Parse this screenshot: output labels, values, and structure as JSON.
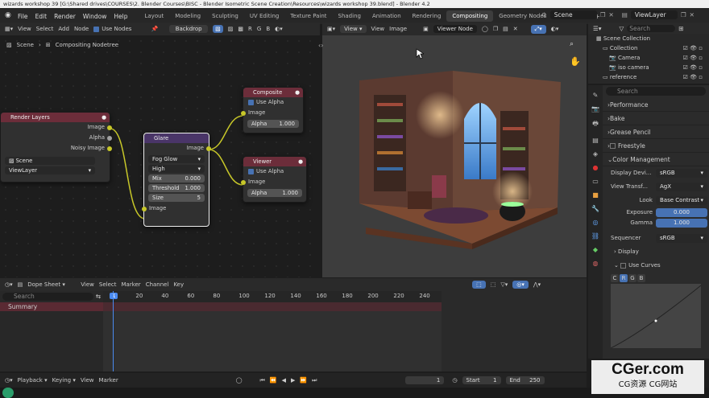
{
  "window_title": "wizards workshop 39 [G:\\Shared drives\\COURSES\\2. Blender Courses\\BISC - Blender Isometric Scene Creation\\Resources\\wizards workshop 39.blend] - Blender 4.2",
  "menu": [
    "File",
    "Edit",
    "Render",
    "Window",
    "Help"
  ],
  "workspaces": [
    "Layout",
    "Modeling",
    "Sculpting",
    "UV Editing",
    "Texture Paint",
    "Shading",
    "Animation",
    "Rendering",
    "Compositing",
    "Geometry Nodes",
    "Scripting"
  ],
  "active_workspace": "Compositing",
  "scene_name": "Scene",
  "view_layer_name": "ViewLayer",
  "node_editor": {
    "menus": [
      "View",
      "Select",
      "Add",
      "Node"
    ],
    "use_nodes_label": "Use Nodes",
    "backdrop_label": "Backdrop",
    "rgb_labels": [
      "R",
      "G",
      "B"
    ],
    "breadcrumb_scene": "Scene",
    "breadcrumb_tree": "Compositing Nodetree",
    "render_layers": {
      "title": "Render Layers",
      "outputs": [
        "Image",
        "Alpha",
        "Noisy Image"
      ],
      "scene": "Scene",
      "view_layer": "ViewLayer"
    },
    "glare": {
      "title": "Glare",
      "output": "Image",
      "type": "Fog Glow",
      "quality": "High",
      "mix_label": "Mix",
      "mix_value": "0.000",
      "threshold_label": "Threshold",
      "threshold_value": "1.000",
      "size_label": "Size",
      "size_value": "5",
      "input": "Image"
    },
    "composite": {
      "title": "Composite",
      "use_alpha": "Use Alpha",
      "image": "Image",
      "alpha_label": "Alpha",
      "alpha_value": "1.000"
    },
    "viewer": {
      "title": "Viewer",
      "use_alpha": "Use Alpha",
      "image": "Image",
      "alpha_label": "Alpha",
      "alpha_value": "1.000"
    }
  },
  "image_editor": {
    "menus": [
      "View",
      "View",
      "Image"
    ],
    "image_name": "Viewer Node"
  },
  "outliner": {
    "search_placeholder": "Search",
    "items": [
      {
        "label": "Scene Collection"
      },
      {
        "label": "Collection"
      },
      {
        "label": "Camera"
      },
      {
        "label": "iso camera"
      },
      {
        "label": "reference"
      }
    ]
  },
  "properties": {
    "search_placeholder": "Search",
    "panels": [
      "Performance",
      "Bake",
      "Grease Pencil",
      "Freestyle",
      "Color Management"
    ],
    "display_device_label": "Display Devi...",
    "display_device": "sRGB",
    "view_transform_label": "View Transf...",
    "view_transform": "AgX",
    "look_label": "Look",
    "look": "Base Contrast",
    "exposure_label": "Exposure",
    "exposure": "0.000",
    "gamma_label": "Gamma",
    "gamma": "1.000",
    "sequencer_label": "Sequencer",
    "sequencer": "sRGB",
    "display_label": "Display",
    "use_curves_label": "Use Curves",
    "curve_channels": [
      "C",
      "R",
      "G",
      "B"
    ]
  },
  "dope_sheet": {
    "mode": "Dope Sheet",
    "menus": [
      "View",
      "Select",
      "Marker",
      "Channel",
      "Key"
    ],
    "search_placeholder": "Search",
    "summary_label": "Summary",
    "frame_ticks": [
      "1",
      "20",
      "40",
      "60",
      "80",
      "100",
      "120",
      "140",
      "160",
      "180",
      "200",
      "220",
      "240"
    ],
    "current_frame": "1"
  },
  "playback_bar": {
    "menus": [
      "Playback",
      "Keying",
      "View",
      "Marker"
    ],
    "current_frame": "1",
    "start_label": "Start",
    "start": "1",
    "end_label": "End",
    "end": "250"
  },
  "watermark": {
    "main": "CGer.com",
    "sub": "CG资源 CG网站"
  }
}
